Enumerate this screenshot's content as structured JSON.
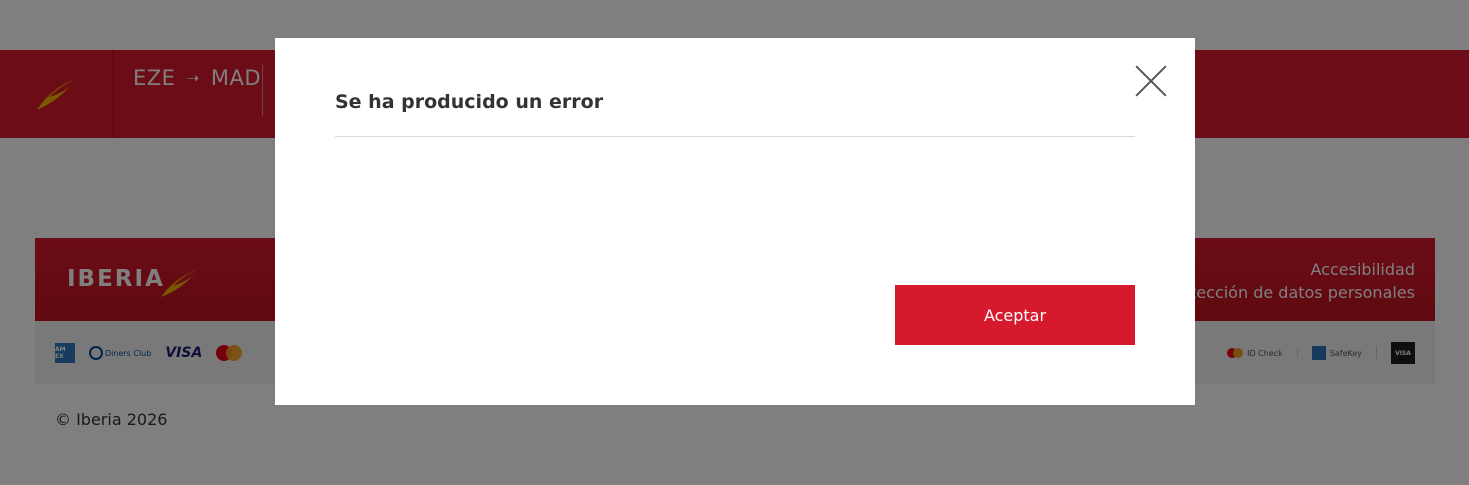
{
  "header": {
    "origin": "EZE",
    "arrow": "➝",
    "destination": "MAD"
  },
  "footer": {
    "brand": "IBERIA",
    "links": [
      "Accesibilidad",
      "Protección de datos personales"
    ],
    "payment_cards": {
      "amex": "AM EX",
      "diners": "Diners Club",
      "visa": "VISA"
    },
    "security": {
      "mc_id_check": "ID Check",
      "amex_safekey": "SafeKey",
      "visa_secure": "VISA"
    },
    "copyright": "© Iberia 2026"
  },
  "modal": {
    "title": "Se ha producido un error",
    "accept_label": "Aceptar"
  },
  "colors": {
    "brand_red": "#d7192d",
    "overlay": "rgba(0,0,0,0.5)"
  }
}
